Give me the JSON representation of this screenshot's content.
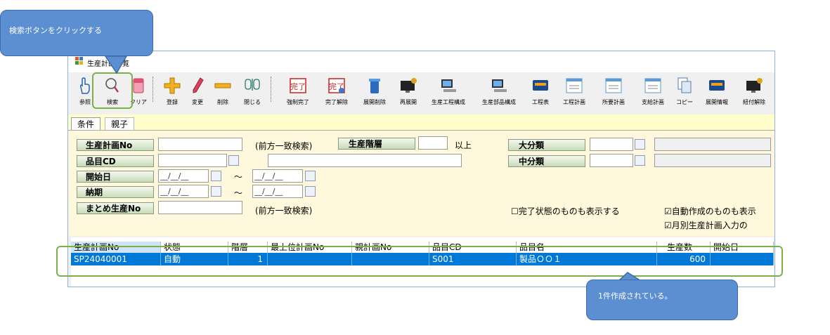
{
  "window": {
    "title": "生産計画一覧"
  },
  "toolbar": {
    "buttons": [
      {
        "label": "参照",
        "icon": "pointer-hand-icon"
      },
      {
        "label": "検索",
        "icon": "magnifier-icon"
      },
      {
        "label": "クリア",
        "icon": "eraser-icon"
      },
      {
        "label": "登録",
        "icon": "plus-icon"
      },
      {
        "label": "変更",
        "icon": "pencil-icon"
      },
      {
        "label": "削除",
        "icon": "minus-icon"
      },
      {
        "label": "閉じる",
        "icon": "close-door-icon"
      },
      {
        "label": "強制完了",
        "icon": "kanryo-stamp-icon"
      },
      {
        "label": "完了解除",
        "icon": "kanryo-undo-icon"
      },
      {
        "label": "展開削除",
        "icon": "trash-icon"
      },
      {
        "label": "再展開",
        "icon": "monitor-gear-icon"
      },
      {
        "label": "生産工程構成",
        "icon": "pc-icon"
      },
      {
        "label": "生産部品構成",
        "icon": "pc-icon"
      },
      {
        "label": "工程表",
        "icon": "screen-icon"
      },
      {
        "label": "工程計画",
        "icon": "chart-window-icon"
      },
      {
        "label": "所要計画",
        "icon": "chart-window-icon"
      },
      {
        "label": "支給計画",
        "icon": "chart-window-icon"
      },
      {
        "label": "コピー",
        "icon": "copy-icon"
      },
      {
        "label": "展開情報",
        "icon": "screen-icon"
      },
      {
        "label": "紐付解除",
        "icon": "monitor-gear-icon"
      }
    ]
  },
  "tabs": [
    {
      "label": "条件"
    },
    {
      "label": "親子"
    }
  ],
  "form": {
    "plan_no_label": "生産計画No",
    "plan_no_note": "(前方一致検索)",
    "level_label": "生産階層",
    "level_note": "以上",
    "major_label": "大分類",
    "item_cd_label": "品目CD",
    "middle_label": "中分類",
    "start_label": "開始日",
    "start_from": "__/__/__",
    "start_to": "__/__/__",
    "tilde": "～",
    "due_label": "納期",
    "due_from": "__/__/__",
    "due_to": "__/__/__",
    "summary_label": "まとめ生産No",
    "summary_note": "(前方一致検索)",
    "chk_completed": "完了状態のものも表示する",
    "chk_auto": "自動作成のものも表示",
    "chk_monthly": "月別生産計画入力の"
  },
  "grid": {
    "columns": [
      "生産計画No",
      "状態",
      "階層",
      "最上位計画No",
      "親計画No",
      "品目CD",
      "品目名",
      "生産数",
      "開始日"
    ],
    "rows": [
      [
        "SP24040001",
        "自動",
        "1",
        "",
        "",
        "S001",
        "製品ＯＯ１",
        "600",
        ""
      ]
    ]
  },
  "annotations": {
    "callout_top": "検索ボタンをクリックする",
    "callout_bottom": "1件作成されている。"
  },
  "colors": {
    "accent": "#0078d7",
    "callout": "#5b8fd1",
    "highlight": "#7ab048",
    "panel": "#fff8dc",
    "tabbar": "#ffffcc"
  }
}
